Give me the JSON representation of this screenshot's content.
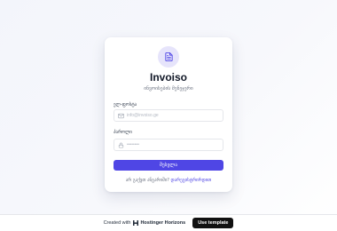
{
  "app": {
    "title": "Invoiso",
    "subtitle": "ინვოისების მენეჯერი",
    "logo_icon": "document-icon",
    "accent_color": "#4f46e5"
  },
  "login_form": {
    "email_label": "ელ-ფოსტა",
    "email_placeholder": "info@invoiso.ge",
    "email_icon": "mail-icon",
    "password_label": "პაროლი",
    "password_placeholder": "••••••••",
    "password_icon": "lock-icon",
    "submit_label": "შესვლა",
    "signup_prompt": "არ გაქვთ ანგარიში?",
    "signup_link": "დარეგისტრირდით"
  },
  "footer": {
    "created_with": "Created with",
    "brand_name": "Hostinger Horizons",
    "template_button": "Use template"
  }
}
